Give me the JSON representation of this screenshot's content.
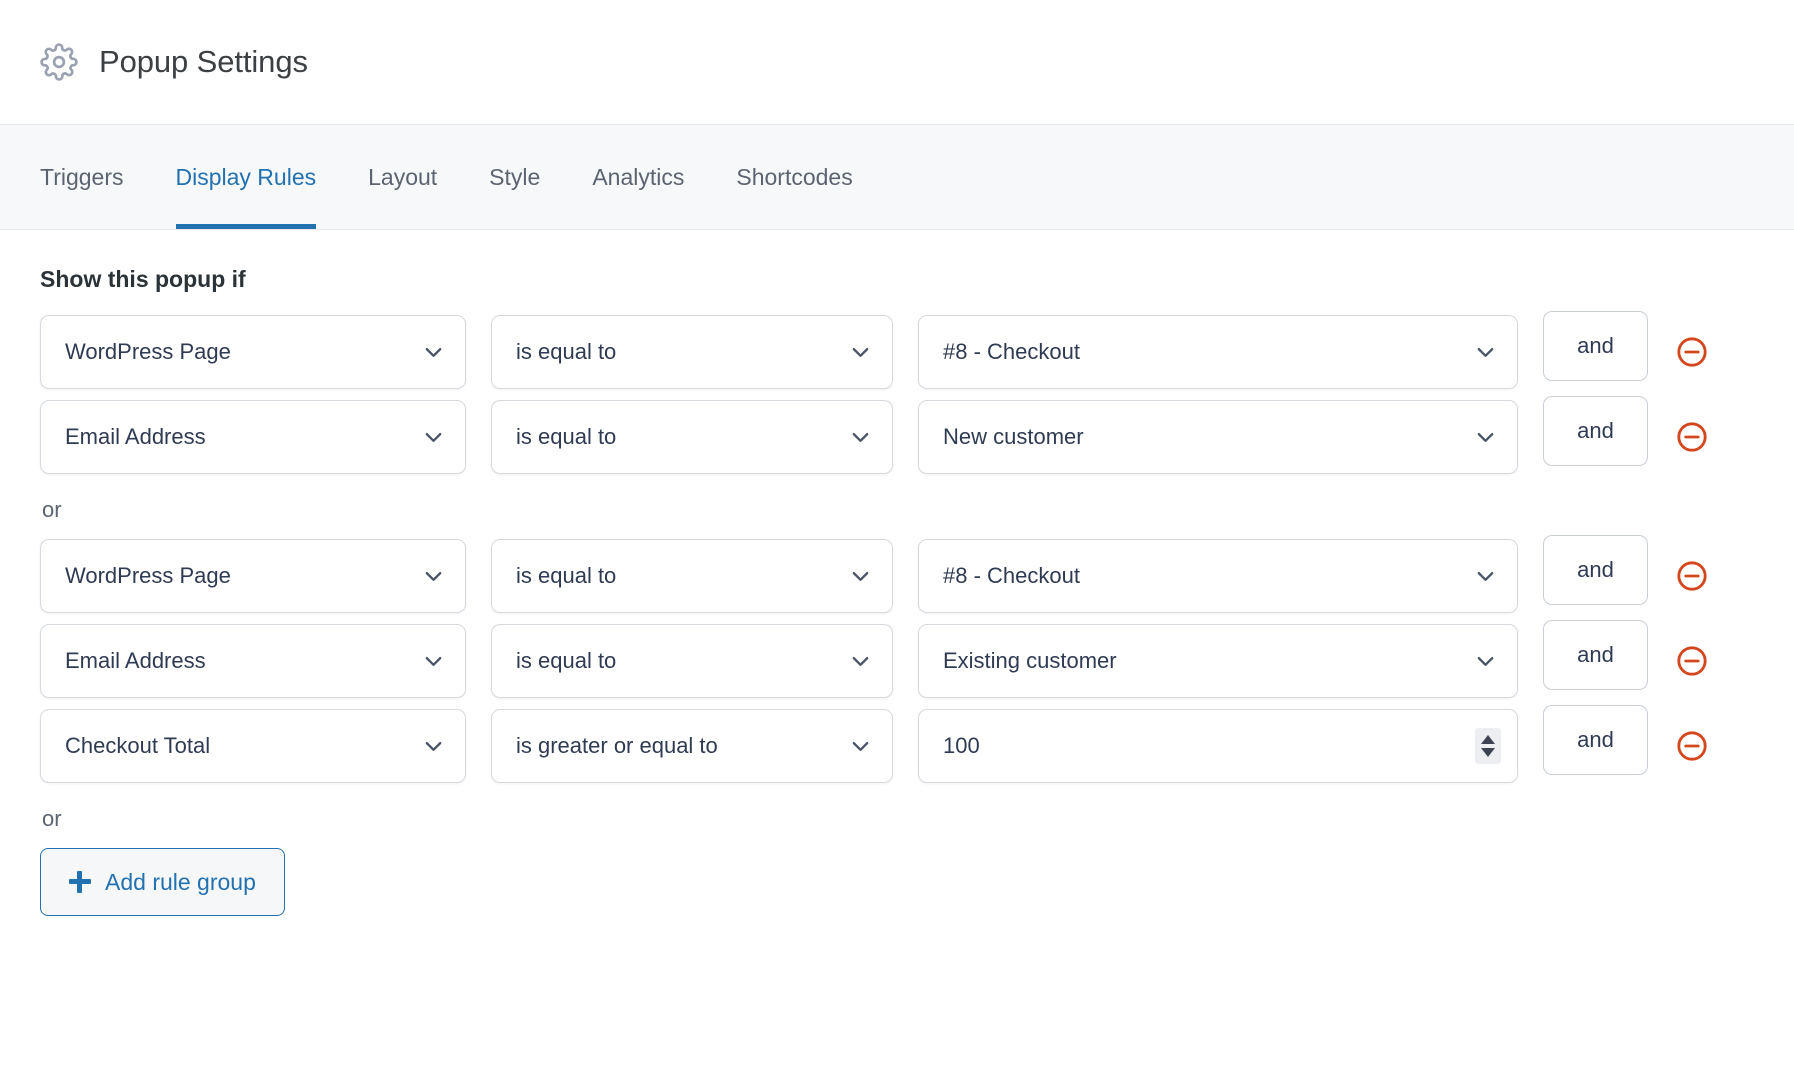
{
  "header": {
    "title": "Popup Settings",
    "icon": "gear-icon"
  },
  "tabs": [
    {
      "label": "Triggers",
      "active": false
    },
    {
      "label": "Display Rules",
      "active": true
    },
    {
      "label": "Layout",
      "active": false
    },
    {
      "label": "Style",
      "active": false
    },
    {
      "label": "Analytics",
      "active": false
    },
    {
      "label": "Shortcodes",
      "active": false
    }
  ],
  "main": {
    "section_heading": "Show this popup if",
    "or_label": "or",
    "and_label": "and",
    "remove_icon": "minus-circle-icon",
    "chevron_icon": "chevron-down-icon",
    "add_group": {
      "label": "Add rule group",
      "icon": "plus-icon"
    },
    "groups": [
      {
        "rules": [
          {
            "field": "WordPress Page",
            "operator": "is equal to",
            "value": "#8 - Checkout",
            "value_type": "select",
            "connector": "and"
          },
          {
            "field": "Email Address",
            "operator": "is equal to",
            "value": "New customer",
            "value_type": "select",
            "connector": "and"
          }
        ]
      },
      {
        "rules": [
          {
            "field": "WordPress Page",
            "operator": "is equal to",
            "value": "#8 - Checkout",
            "value_type": "select",
            "connector": "and"
          },
          {
            "field": "Email Address",
            "operator": "is equal to",
            "value": "Existing customer",
            "value_type": "select",
            "connector": "and"
          },
          {
            "field": "Checkout Total",
            "operator": "is greater or equal to",
            "value": "100",
            "value_type": "number",
            "connector": "and"
          }
        ]
      }
    ]
  },
  "colors": {
    "accent": "#2271b1",
    "remove": "#d4471c",
    "text": "#2f3b52",
    "muted": "#5b6470",
    "tabbar_bg": "#f7f8fa",
    "border": "#d6dade"
  }
}
